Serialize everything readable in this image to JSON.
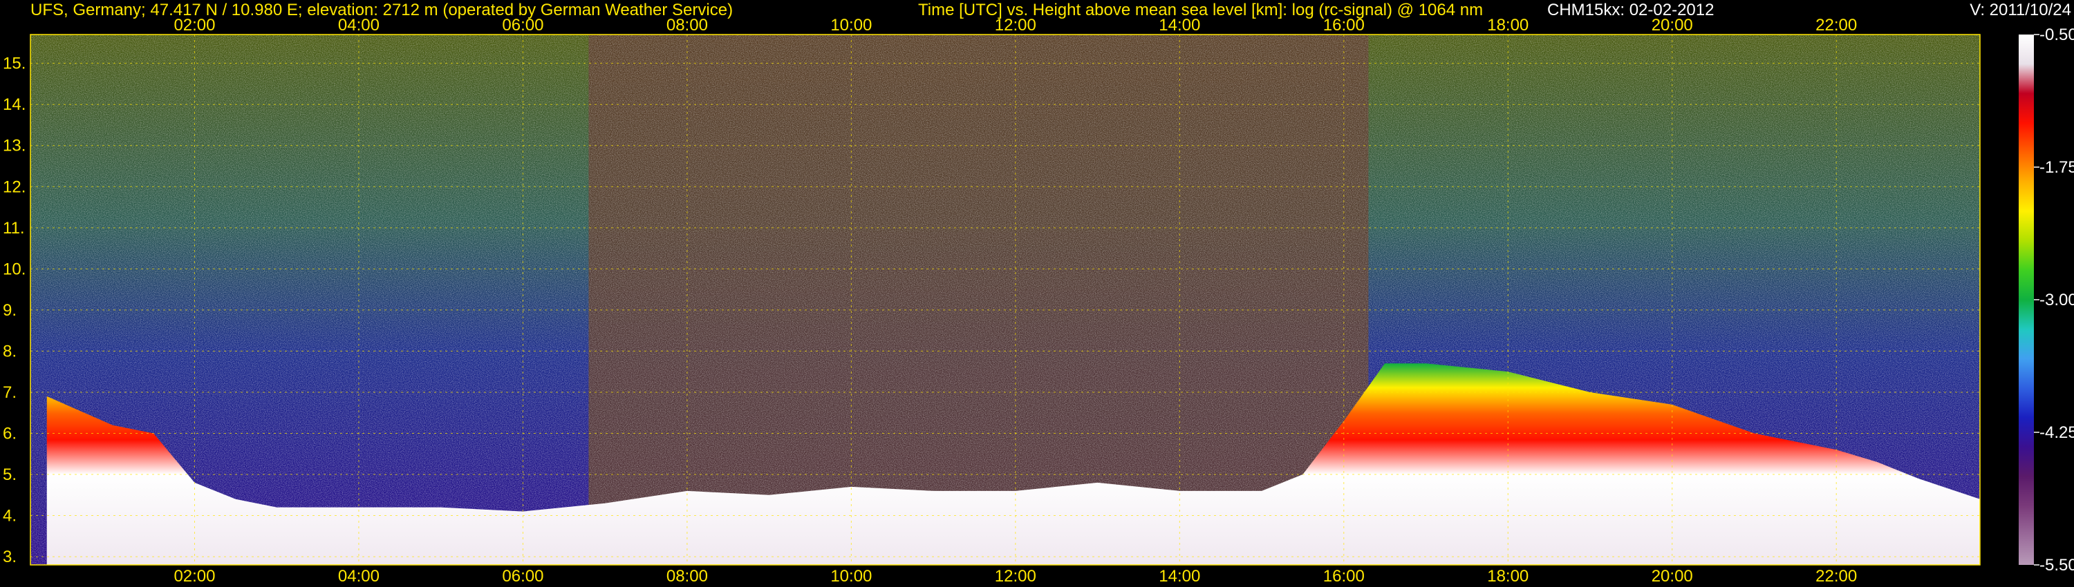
{
  "header": {
    "station": "UFS, Germany; 47.417 N / 10.980 E; elevation: 2712 m  (operated by German Weather Service)",
    "plot_title": "Time [UTC] vs. Height above mean sea level [km]: log (rc-signal) @ 1064 nm",
    "instrument_date": "CHM15kx: 02-02-2012",
    "version": "V: 2011/10/24"
  },
  "chart_data": {
    "type": "heatmap",
    "title": "Time [UTC] vs. Height above mean sea level [km]: log (rc-signal) @ 1064 nm",
    "xlabel": "Time [UTC]",
    "ylabel": "Height above mean sea level [km]",
    "x_unit": "hours UTC",
    "xlim": [
      0,
      23.75
    ],
    "ylim": [
      2.8,
      15.7
    ],
    "x_ticks": [
      {
        "value": 2,
        "label": "02:00"
      },
      {
        "value": 4,
        "label": "04:00"
      },
      {
        "value": 6,
        "label": "06:00"
      },
      {
        "value": 8,
        "label": "08:00"
      },
      {
        "value": 10,
        "label": "10:00"
      },
      {
        "value": 12,
        "label": "12:00"
      },
      {
        "value": 14,
        "label": "14:00"
      },
      {
        "value": 16,
        "label": "16:00"
      },
      {
        "value": 18,
        "label": "18:00"
      },
      {
        "value": 20,
        "label": "20:00"
      },
      {
        "value": 22,
        "label": "22:00"
      }
    ],
    "y_ticks": [
      {
        "value": 3,
        "label": "3."
      },
      {
        "value": 4,
        "label": "4."
      },
      {
        "value": 5,
        "label": "5."
      },
      {
        "value": 6,
        "label": "6."
      },
      {
        "value": 7,
        "label": "7."
      },
      {
        "value": 8,
        "label": "8."
      },
      {
        "value": 9,
        "label": "9."
      },
      {
        "value": 10,
        "label": "10."
      },
      {
        "value": 11,
        "label": "11."
      },
      {
        "value": 12,
        "label": "12."
      },
      {
        "value": 13,
        "label": "13."
      },
      {
        "value": 14,
        "label": "14."
      },
      {
        "value": 15,
        "label": "15."
      }
    ],
    "grid": true,
    "colorbar": {
      "range": [
        -5.5,
        -0.5
      ],
      "ticks": [
        {
          "value": -0.5,
          "label": "-0.50"
        },
        {
          "value": -1.75,
          "label": "-1.75"
        },
        {
          "value": -3.0,
          "label": "-3.00"
        },
        {
          "value": -4.25,
          "label": "-4.25"
        },
        {
          "value": -5.5,
          "label": "-5.50"
        }
      ],
      "colors_low_to_high": [
        "#b89ab8",
        "#9a6a9a",
        "#7a3a7a",
        "#5a1a6a",
        "#3a1090",
        "#1a20c0",
        "#2f5fe0",
        "#40a0f0",
        "#20c8c0",
        "#10b040",
        "#40d020",
        "#b0e000",
        "#fff000",
        "#ffb000",
        "#ff6000",
        "#ff1000",
        "#c00020",
        "#e8e0e8",
        "#ffffff"
      ]
    },
    "boundary_layer_top_km": {
      "x": [
        0.2,
        1.0,
        1.5,
        2.0,
        2.5,
        3.0,
        4.0,
        5.0,
        6.0,
        7.0,
        8.0,
        9.0,
        10.0,
        11.0,
        12.0,
        13.0,
        14.0,
        15.0,
        15.5,
        16.0,
        16.5,
        17.0,
        18.0,
        19.0,
        20.0,
        21.0,
        22.0,
        22.5,
        23.0,
        23.75
      ],
      "y": [
        6.9,
        6.2,
        6.0,
        4.8,
        4.4,
        4.2,
        4.2,
        4.2,
        4.1,
        4.3,
        4.6,
        4.5,
        4.7,
        4.6,
        4.6,
        4.8,
        4.6,
        4.6,
        5.0,
        6.3,
        7.7,
        7.7,
        7.5,
        7.0,
        6.7,
        6.0,
        5.6,
        5.3,
        4.9,
        4.4
      ]
    },
    "high_noise_period_hours": [
      6.8,
      16.3
    ]
  }
}
